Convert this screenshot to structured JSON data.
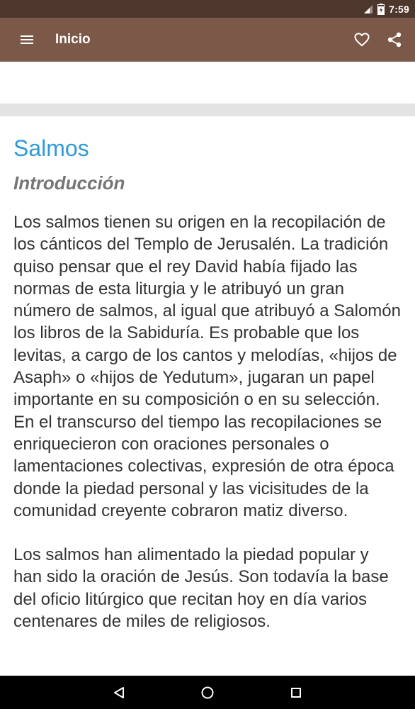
{
  "status_bar": {
    "time": "7:59",
    "icons": [
      "signal-icon",
      "battery-icon"
    ]
  },
  "app_bar": {
    "title": "Inicio",
    "icons": [
      "menu-icon",
      "heart-icon",
      "share-icon"
    ]
  },
  "article": {
    "title": "Salmos",
    "subtitle": "Introducción",
    "paragraphs": [
      "Los salmos tienen su origen en la recopilación de los cánticos del Templo de Jerusalén. La tradición quiso pensar que el rey David había fijado las normas de esta liturgia y le atribuyó un gran número de salmos, al igual que atribuyó a Salomón los libros de la Sabiduría. Es probable que los levitas, a cargo de los cantos y melodías, «hijos de Asaph» o «hijos de Yedutum», jugaran un papel importante en su composición o en su selección. En el transcurso del tiempo las recopilaciones se enriquecieron con oraciones personales o lamentaciones colectivas, expresión de otra época donde la piedad personal y las vicisitudes de la comunidad creyente cobraron matiz diverso.",
      "Los salmos han alimentado la piedad popular y han sido la oración de Jesús. Son todavía la base del oficio litúrgico que recitan hoy en día varios centenares de miles de religiosos."
    ]
  },
  "nav_bar": {
    "icons": [
      "back-icon",
      "home-icon",
      "recents-icon"
    ]
  },
  "colors": {
    "status_bar": "#4d362c",
    "app_bar": "#7b5848",
    "title": "#2e9bd6",
    "subtitle": "#757575",
    "body_text": "#333333"
  }
}
